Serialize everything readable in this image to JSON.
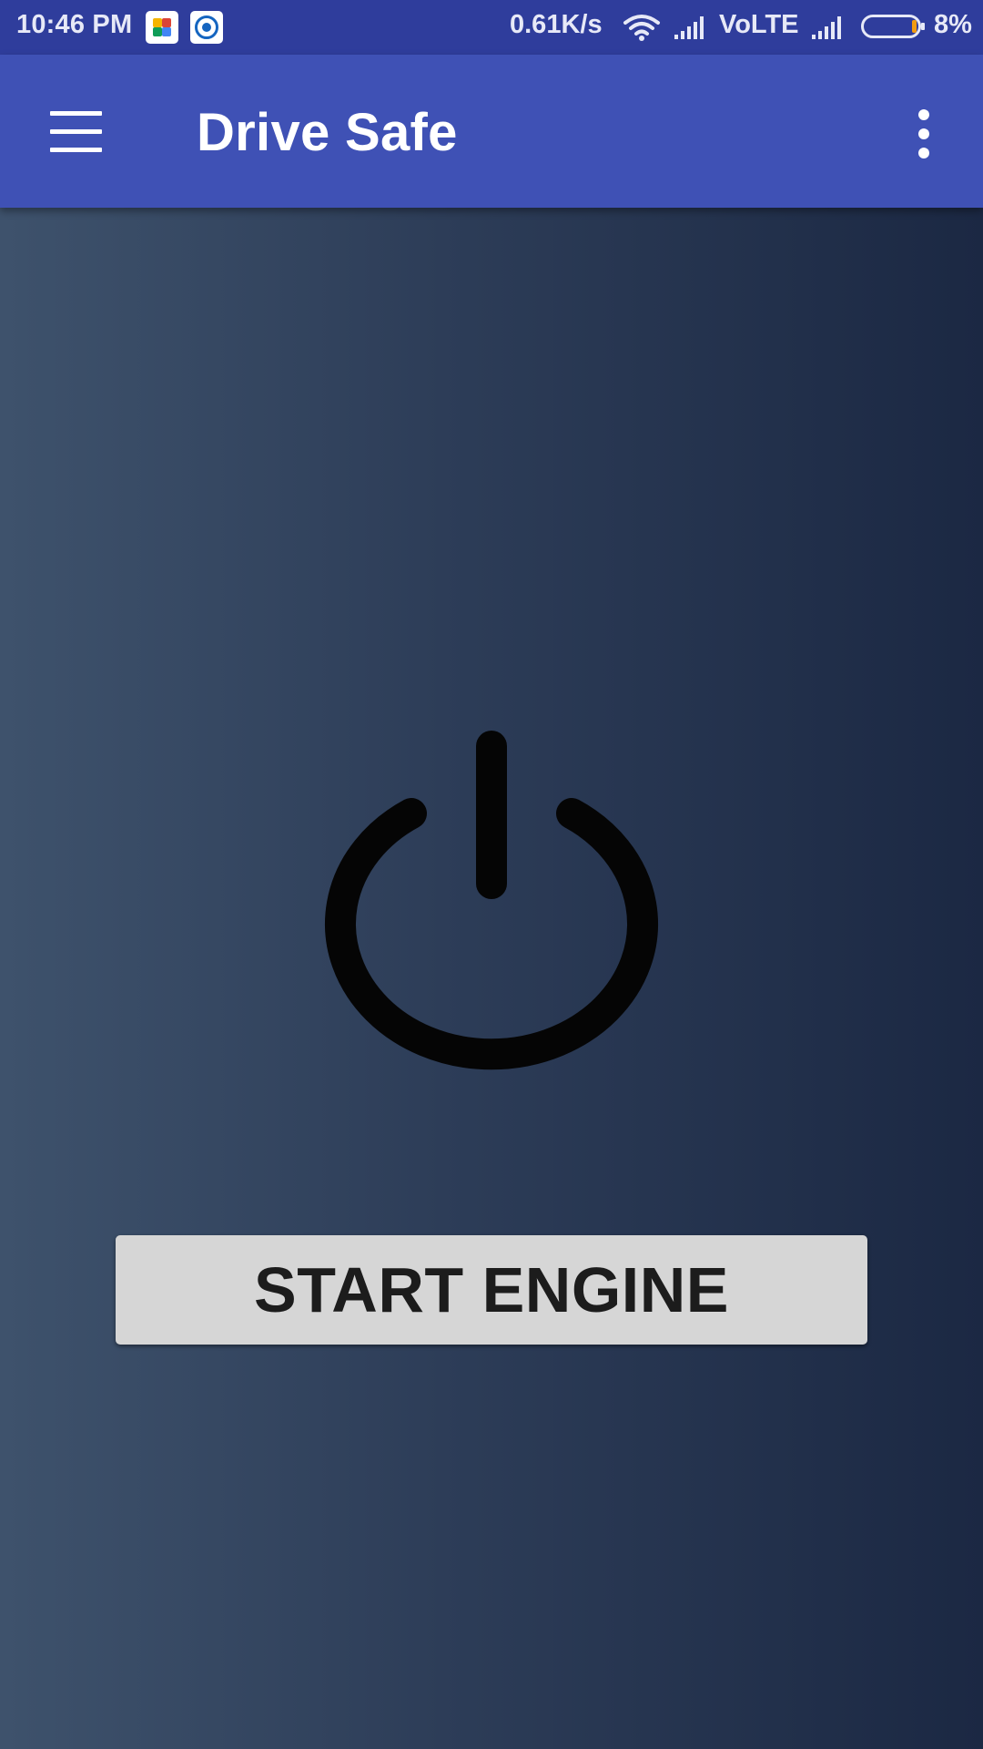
{
  "status_bar": {
    "time": "10:46 PM",
    "network_speed": "0.61K/s",
    "network_type": "VoLTE",
    "battery_percent": "8%",
    "battery_level": 0.08,
    "battery_level_color": "#f39c12",
    "notification_icons": [
      "play-games-icon",
      "camera-icon"
    ],
    "status_icons": [
      "wifi-icon",
      "signal-icon",
      "signal-icon",
      "battery-icon"
    ]
  },
  "app_bar": {
    "title": "Drive Safe",
    "background_color": "#3f51b5",
    "left_icon": "menu-icon",
    "right_icon": "more-vert-icon"
  },
  "main": {
    "power_icon": "power-icon",
    "start_button_label": "START ENGINE"
  }
}
